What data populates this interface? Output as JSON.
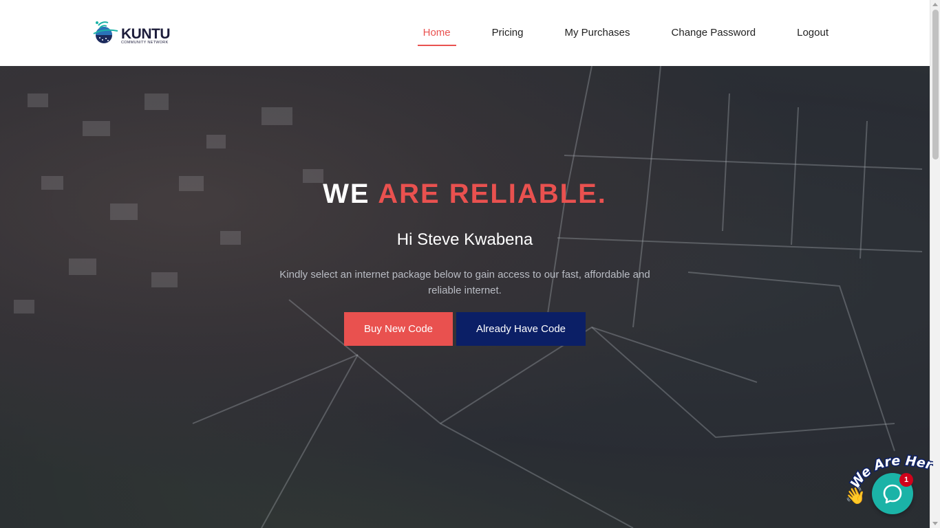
{
  "brand": {
    "name": "KUNTU",
    "tagline": "COMMUNITY NETWORK",
    "colors": {
      "accent": "#e9514f",
      "navy": "#0b1f66",
      "chat": "#1bb3a7"
    }
  },
  "nav": {
    "items": [
      {
        "label": "Home",
        "active": true
      },
      {
        "label": "Pricing",
        "active": false
      },
      {
        "label": "My Purchases",
        "active": false
      },
      {
        "label": "Change Password",
        "active": false
      },
      {
        "label": "Logout",
        "active": false
      }
    ]
  },
  "hero": {
    "title_plain": "WE ",
    "title_accent": "ARE RELIABLE.",
    "greeting": "Hi Steve Kwabena",
    "description": "Kindly select an internet package below to gain access to our fast, affordable and reliable internet.",
    "buy_button": "Buy New Code",
    "have_button": "Already Have Code"
  },
  "chat": {
    "tag_text": "We Are Here!",
    "badge_count": "1",
    "icon": "chat-bubble-icon",
    "wave_icon": "waving-hand-icon"
  }
}
